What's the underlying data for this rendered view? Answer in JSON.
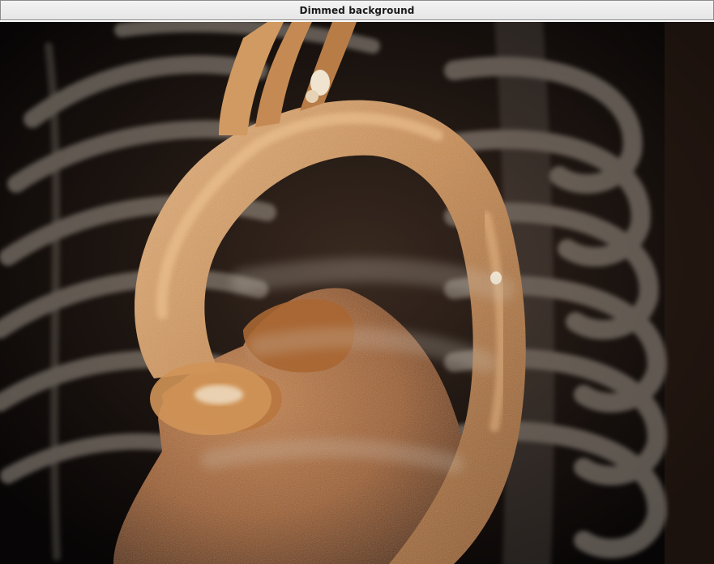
{
  "window": {
    "title": "Dimmed background"
  },
  "render": {
    "foreground_color": "#c98a4f",
    "background_color": "#0b0806",
    "ribcage_color": "#bdb3a6"
  }
}
